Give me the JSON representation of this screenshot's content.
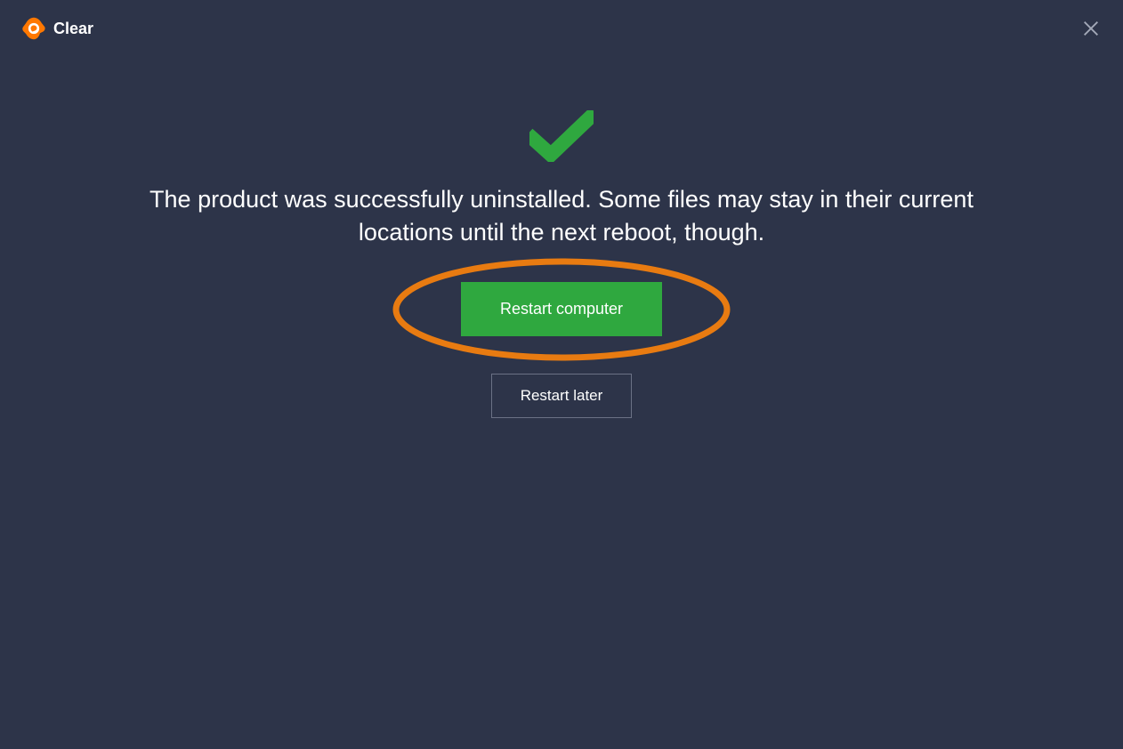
{
  "header": {
    "app_name": "Clear",
    "colors": {
      "logo_orange": "#ff7800",
      "logo_white": "#ffffff"
    }
  },
  "content": {
    "message": "The product was successfully uninstalled. Some files may stay in their current locations until the next reboot, though.",
    "checkmark_color": "#2fa83f"
  },
  "buttons": {
    "restart_now_label": "Restart computer",
    "restart_later_label": "Restart later"
  },
  "annotation": {
    "ellipse_color": "#e87b11"
  }
}
